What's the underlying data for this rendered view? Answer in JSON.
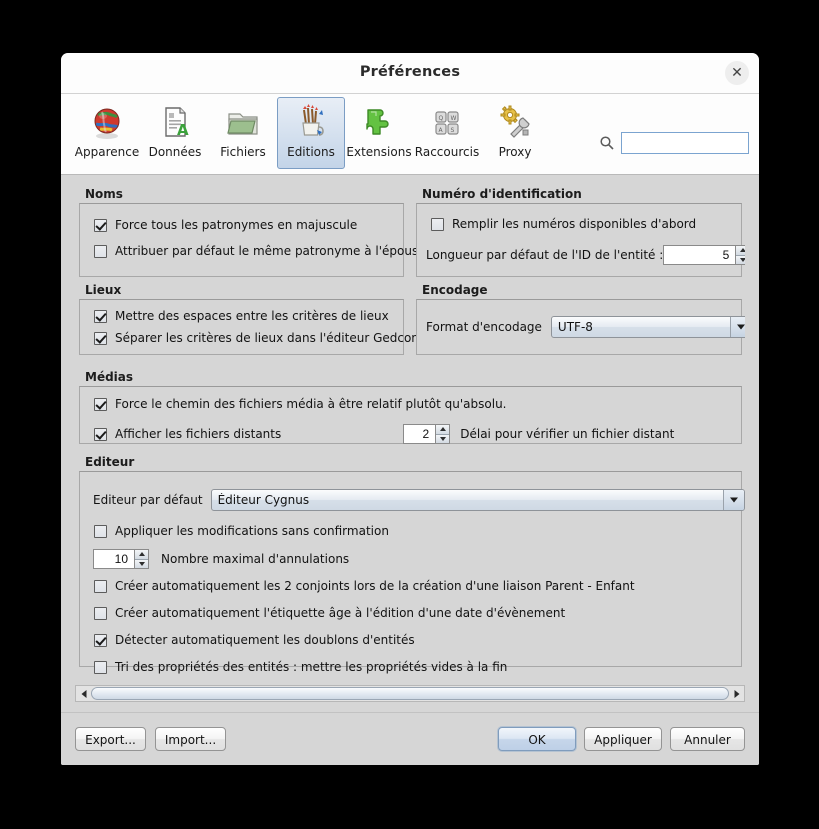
{
  "window": {
    "title": "Préférences",
    "close_label": "✕"
  },
  "toolbar": {
    "items": [
      {
        "label": "Apparence",
        "icon": "globe-icon",
        "selected": false
      },
      {
        "label": "Données",
        "icon": "document-a-icon",
        "selected": false
      },
      {
        "label": "Fichiers",
        "icon": "folder-icon",
        "selected": false
      },
      {
        "label": "Editions",
        "icon": "pencil-cup-icon",
        "selected": true
      },
      {
        "label": "Extensions",
        "icon": "puzzle-piece-icon",
        "selected": false
      },
      {
        "label": "Raccourcis",
        "icon": "keyboard-keys-icon",
        "selected": false
      },
      {
        "label": "Proxy",
        "icon": "gear-wrench-icon",
        "selected": false
      }
    ],
    "search": {
      "icon": "search-icon",
      "value": "",
      "placeholder": ""
    }
  },
  "groups": {
    "noms": {
      "title": "Noms",
      "options": [
        {
          "label": "Force tous les patronymes en majuscule",
          "checked": true
        },
        {
          "label": "Attribuer par défaut le même patronyme à l'épouse",
          "checked": false
        }
      ]
    },
    "identification": {
      "title": "Numéro d'identification",
      "options": [
        {
          "label": "Remplir les numéros disponibles d'abord",
          "checked": false
        }
      ],
      "id_length_label": "Longueur par défaut de l'ID de l'entité :",
      "id_length_value": "5"
    },
    "lieux": {
      "title": "Lieux",
      "options": [
        {
          "label": "Mettre des espaces entre les critères de lieux",
          "checked": true
        },
        {
          "label": "Séparer les critères de lieux dans l'éditeur Gedcom",
          "checked": true
        }
      ]
    },
    "encodage": {
      "title": "Encodage",
      "format_label": "Format d'encodage",
      "format_value": "UTF-8"
    },
    "medias": {
      "title": "Médias",
      "options": [
        {
          "label": "Force le chemin des fichiers média à être relatif plutôt qu'absolu.",
          "checked": true
        },
        {
          "label": "Afficher les fichiers distants",
          "checked": true
        }
      ],
      "delay_value": "2",
      "delay_label": "Délai pour vérifier un fichier distant"
    },
    "editeur": {
      "title": "Editeur",
      "default_editor_label": "Editeur par défaut",
      "default_editor_value": "Éditeur Cygnus",
      "apply_without_confirm": {
        "label": "Appliquer les modifications sans confirmation",
        "checked": false
      },
      "undo_value": "10",
      "undo_label": "Nombre maximal d'annulations",
      "options": [
        {
          "label": "Créer automatiquement les 2 conjoints lors de la création d'une liaison Parent - Enfant",
          "checked": false
        },
        {
          "label": "Créer automatiquement l'étiquette âge à l'édition d'une date d'évènement",
          "checked": false
        },
        {
          "label": "Détecter automatiquement les doublons d'entités",
          "checked": true
        },
        {
          "label": "Tri des propriétés des entités : mettre les propriétés vides à la fin",
          "checked": false
        }
      ]
    }
  },
  "scrollbar": {
    "left_icon": "arrow-left-icon",
    "right_icon": "arrow-right-icon"
  },
  "buttons": {
    "export": "Export...",
    "import": "Import...",
    "ok": "OK",
    "apply": "Appliquer",
    "cancel": "Annuler"
  },
  "colors": {
    "dialog_bg": "#d6d6d6",
    "titlebar_bg": "#fdfdfd",
    "selected_tab": "#c3d4e8",
    "accent_border": "#7ba4d0"
  }
}
